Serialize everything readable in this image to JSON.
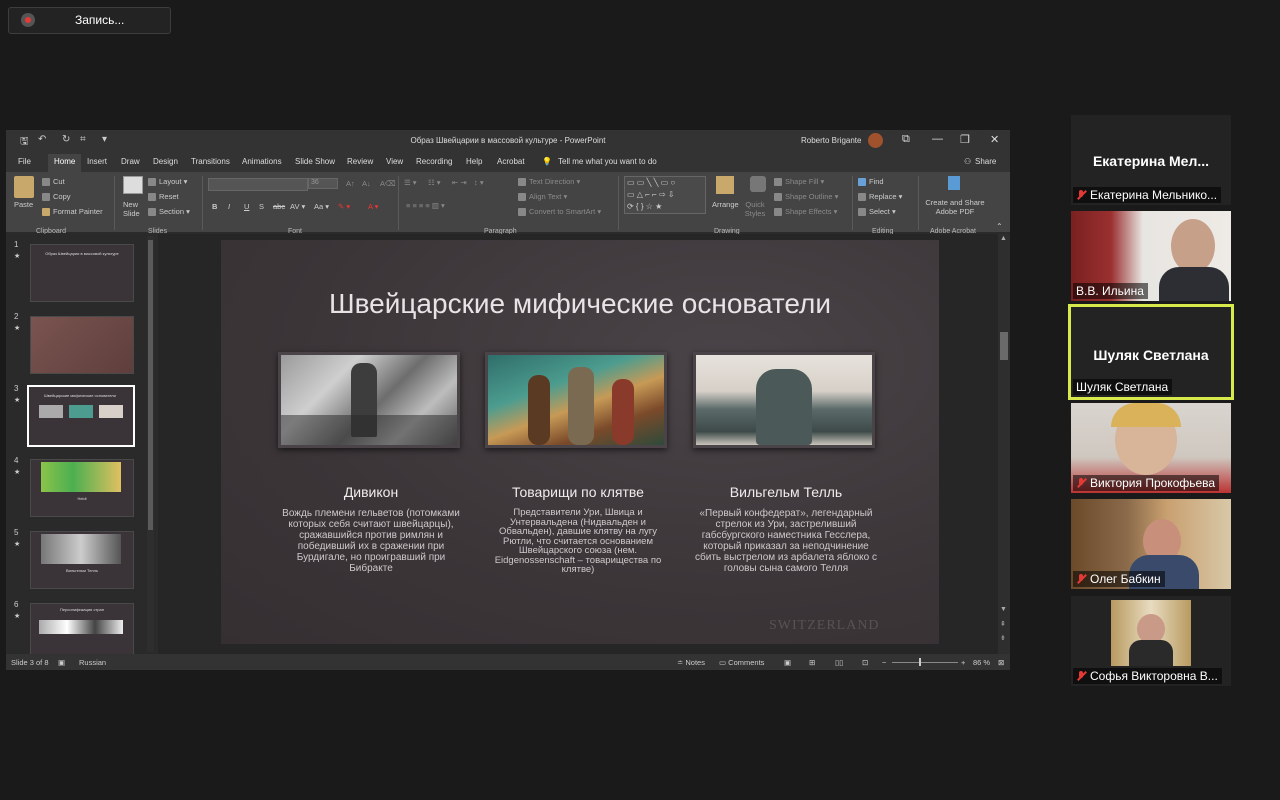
{
  "recording": {
    "label": "Запись..."
  },
  "window": {
    "title": "Образ Швейцарии в массовой культуре  -  PowerPoint",
    "user": "Roberto Brigante"
  },
  "tabs": [
    "File",
    "Home",
    "Insert",
    "Draw",
    "Design",
    "Transitions",
    "Animations",
    "Slide Show",
    "Review",
    "View",
    "Recording",
    "Help",
    "Acrobat"
  ],
  "tell_me": "Tell me what you want to do",
  "share": "Share",
  "ribbon": {
    "clipboard": {
      "paste": "Paste",
      "cut": "Cut",
      "copy": "Copy",
      "format_painter": "Format Painter",
      "group": "Clipboard"
    },
    "slides": {
      "new_slide": "New Slide",
      "layout": "Layout",
      "reset": "Reset",
      "section": "Section",
      "group": "Slides"
    },
    "font": {
      "size": "36",
      "group": "Font",
      "bold": "B",
      "italic": "I",
      "underline": "U",
      "strike": "S",
      "abc": "abc"
    },
    "paragraph": {
      "text_direction": "Text Direction",
      "align_text": "Align Text",
      "smartart": "Convert to SmartArt",
      "group": "Paragraph"
    },
    "drawing": {
      "arrange": "Arrange",
      "quick_styles": "Quick Styles",
      "shape_fill": "Shape Fill",
      "shape_outline": "Shape Outline",
      "shape_effects": "Shape Effects",
      "group": "Drawing"
    },
    "editing": {
      "find": "Find",
      "replace": "Replace",
      "select": "Select",
      "group": "Editing"
    },
    "acrobat": {
      "create": "Create and Share Adobe PDF",
      "group": "Adobe Acrobat"
    }
  },
  "thumbnails": [
    {
      "num": "1",
      "title": "Образ Швейцарии в массовой культуре"
    },
    {
      "num": "2",
      "title": ""
    },
    {
      "num": "3",
      "title": "Швейцарские мифические основатели"
    },
    {
      "num": "4",
      "title": "Heidi"
    },
    {
      "num": "5",
      "title": "Вильгельм Телль"
    },
    {
      "num": "6",
      "title": "Персонификация стран"
    }
  ],
  "slide": {
    "title": "Швейцарские мифические основатели",
    "watermark": "SWITZERLAND",
    "columns": [
      {
        "heading": "Дивикон",
        "text": "Вождь племени гельветов (потомками которых себя считают швейцарцы), сражавшийся против римлян и победивший их в сражении при Бурдигале, но проигравший при Бибракте"
      },
      {
        "heading": "Товарищи по клятве",
        "text": "Представители Ури, Швица и Унтервальдена (Нидвальден и Обвальден), давшие клятву на лугу Рютли, что считается основанием Швейцарского союза (нем. Eidgenossenschaft – товарищества по клятве)"
      },
      {
        "heading": "Вильгельм Телль",
        "text": "«Первый конфедерат», легендарный стрелок из Ури, застреливший габсбургского наместника Гесслера, который приказал за неподчинение сбить выстрелом из арбалета яблоко с головы сына самого Телля"
      }
    ]
  },
  "status": {
    "slide_of": "Slide 3 of 8",
    "language": "Russian",
    "notes": "Notes",
    "comments": "Comments",
    "zoom": "86 %"
  },
  "participants": [
    {
      "name": "Екатерина Мельнико...",
      "big": "Екатерина  Мел...",
      "muted": true,
      "video": false
    },
    {
      "name": "В.В. Ильина",
      "big": "",
      "muted": false,
      "video": true
    },
    {
      "name": "Шуляк Светлана",
      "big": "Шуляк Светлана",
      "muted": false,
      "video": false,
      "active": true
    },
    {
      "name": "Виктория Прокофьева",
      "big": "",
      "muted": true,
      "video": true
    },
    {
      "name": "Олег Бабкин",
      "big": "",
      "muted": true,
      "video": true
    },
    {
      "name": "Софья Викторовна В...",
      "big": "",
      "muted": true,
      "video": true
    }
  ]
}
